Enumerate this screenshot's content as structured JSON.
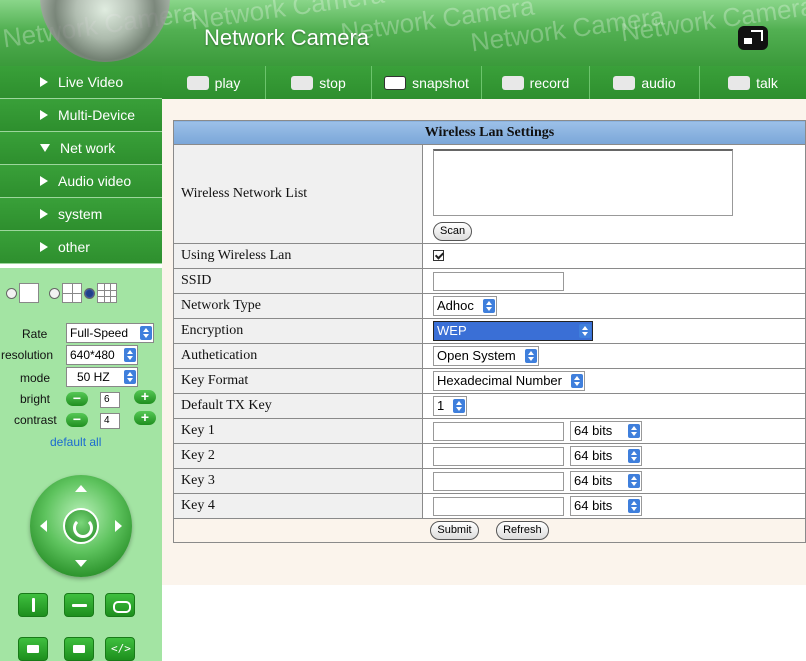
{
  "header": {
    "title": "Network Camera",
    "watermark": "Network Camera"
  },
  "nav": {
    "items": [
      {
        "label": "Live Video",
        "expanded": false
      },
      {
        "label": "Multi-Device",
        "expanded": false
      },
      {
        "label": "Net work",
        "expanded": true
      },
      {
        "label": "Audio video",
        "expanded": false
      },
      {
        "label": "system",
        "expanded": false
      },
      {
        "label": "other",
        "expanded": false
      }
    ]
  },
  "toolbar": {
    "play": "play",
    "stop": "stop",
    "snapshot": "snapshot",
    "record": "record",
    "audio": "audio",
    "talk": "talk"
  },
  "controls": {
    "rate_label": "Rate",
    "rate_value": "Full-Speed",
    "resolution_label": "resolution",
    "resolution_value": "640*480",
    "mode_label": "mode",
    "mode_value": "50 HZ",
    "bright_label": "bright",
    "bright_value": "6",
    "contrast_label": "contrast",
    "contrast_value": "4",
    "default_all": "default all",
    "minus": "−",
    "plus": "+"
  },
  "wireless": {
    "title": "Wireless Lan Settings",
    "network_list_label": "Wireless Network List",
    "scan_button": "Scan",
    "using_wireless_label": "Using Wireless Lan",
    "using_wireless_checked": true,
    "ssid_label": "SSID",
    "ssid_value": "",
    "network_type_label": "Network Type",
    "network_type_value": "Adhoc",
    "encryption_label": "Encryption",
    "encryption_value": "WEP",
    "authentication_label": "Authetication",
    "authentication_value": "Open System",
    "key_format_label": "Key Format",
    "key_format_value": "Hexadecimal Number",
    "default_tx_key_label": "Default TX Key",
    "default_tx_key_value": "1",
    "keys": [
      {
        "label": "Key 1",
        "value": "",
        "bits": "64 bits"
      },
      {
        "label": "Key 2",
        "value": "",
        "bits": "64 bits"
      },
      {
        "label": "Key 3",
        "value": "",
        "bits": "64 bits"
      },
      {
        "label": "Key 4",
        "value": "",
        "bits": "64 bits"
      }
    ],
    "submit_button": "Submit",
    "refresh_button": "Refresh"
  },
  "colors": {
    "nav_green": "#2e8f2e",
    "panel_green": "#a3e4a3",
    "title_blue": "#7aa6d8",
    "select_highlight": "#3a6fd6"
  }
}
